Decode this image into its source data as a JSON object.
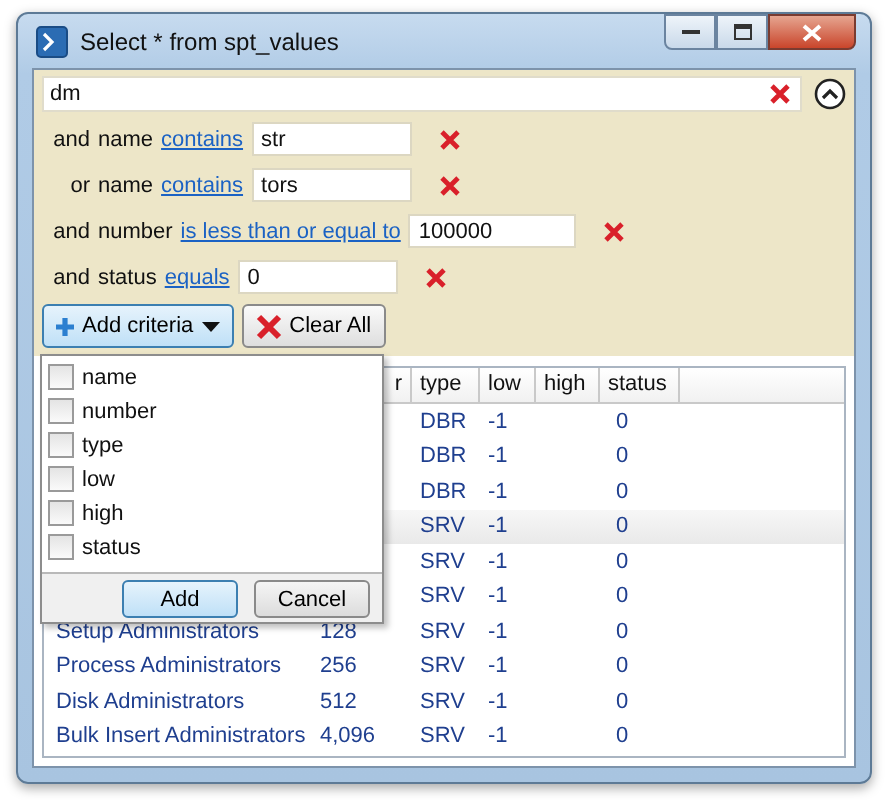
{
  "window": {
    "title": "Select * from spt_values"
  },
  "search": {
    "value": "dm"
  },
  "criteria": [
    {
      "conjunction": "and",
      "field": "name",
      "operator": "contains",
      "value": "str"
    },
    {
      "conjunction": "or",
      "field": "name",
      "operator": "contains",
      "value": "tors"
    },
    {
      "conjunction": "and",
      "field": "number",
      "operator": "is less than or equal to",
      "value": "100000"
    },
    {
      "conjunction": "and",
      "field": "status",
      "operator": "equals",
      "value": "0"
    }
  ],
  "buttons": {
    "add_criteria": "Add criteria",
    "clear_all": "Clear All"
  },
  "popup": {
    "fields": [
      {
        "label": "name",
        "checked": false
      },
      {
        "label": "number",
        "checked": false
      },
      {
        "label": "type",
        "checked": false
      },
      {
        "label": "low",
        "checked": false
      },
      {
        "label": "high",
        "checked": false
      },
      {
        "label": "status",
        "checked": false
      }
    ],
    "add": "Add",
    "cancel": "Cancel"
  },
  "table": {
    "columns": [
      "r",
      "type",
      "low",
      "high",
      "status"
    ],
    "rows": [
      {
        "type": "DBR",
        "low": "-1",
        "status": "0",
        "selected": false
      },
      {
        "type": "DBR",
        "low": "-1",
        "status": "0",
        "selected": false
      },
      {
        "type": "DBR",
        "low": "-1",
        "status": "0",
        "selected": false
      },
      {
        "type": "SRV",
        "low": "-1",
        "status": "0",
        "selected": true
      },
      {
        "type": "SRV",
        "low": "-1",
        "status": "0",
        "selected": false
      },
      {
        "type": "SRV",
        "low": "-1",
        "status": "0",
        "selected": false
      },
      {
        "name": "Setup Administrators",
        "number": "128",
        "type": "SRV",
        "low": "-1",
        "status": "0",
        "selected": false
      },
      {
        "name": "Process Administrators",
        "number": "256",
        "type": "SRV",
        "low": "-1",
        "status": "0",
        "selected": false
      },
      {
        "name": "Disk Administrators",
        "number": "512",
        "type": "SRV",
        "low": "-1",
        "status": "0",
        "selected": false
      },
      {
        "name": "Bulk Insert Administrators",
        "number": "4,096",
        "type": "SRV",
        "low": "-1",
        "status": "0",
        "selected": false
      }
    ]
  }
}
